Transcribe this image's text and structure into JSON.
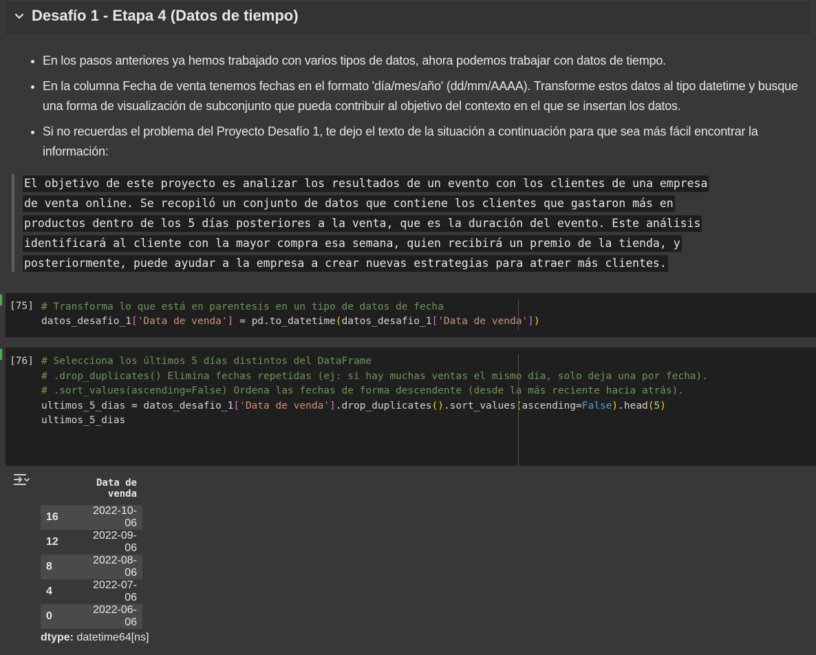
{
  "section": {
    "title": "Desafío 1 - Etapa 4 (Datos de tiempo)"
  },
  "bullets": [
    "En los pasos anteriores ya hemos trabajado con varios tipos de datos, ahora podemos trabajar con datos de tiempo.",
    "En la columna Fecha de venta tenemos fechas en el formato 'día/mes/año' (dd/mm/AAAA). Transforme estos datos al tipo datetime y busque una forma de visualización de subconjunto que pueda contribuir al objetivo del contexto en el que se insertan los datos.",
    "Si no recuerdas el problema del Proyecto Desafío 1, te dejo el texto de la situación a continuación para que sea más fácil encontrar la información:"
  ],
  "quote": [
    "El objetivo de este proyecto es analizar los resultados de un evento con los clientes de una empresa",
    "de venta online. Se recopiló un conjunto de datos que contiene los clientes que gastaron más en",
    "productos dentro de los 5 días posteriores a la venta, que es la duración del evento. Este análisis",
    "identificará al cliente con la mayor compra esa semana, quien recibirá un premio de la tienda, y",
    "posteriormente, puede ayudar a la empresa a crear nuevas estrategias para atraer más clientes."
  ],
  "cell1": {
    "count": "[75]",
    "comment": "# Transforma lo que está en parentesis en un tipo de datos de fecha",
    "l2_a": "datos_desafio_1",
    "l2_str1": "'Data de venda'",
    "l2_b": " = pd.to_datetime",
    "l2_c": "datos_desafio_1",
    "l2_str2": "'Data de venda'"
  },
  "cell2": {
    "count": "[76]",
    "comment1": "# Selecciona los últimos 5 días distintos del DataFrame",
    "comment2": "# .drop_duplicates() Elimina fechas repetidas (ej: si hay muchas ventas el mismo día, solo deja una por fecha).",
    "comment3": "# .sort_values(ascending=False) Ordena las fechas de forma descendente (desde la más reciente hacia atrás).",
    "l4_a": "ultimos_5_dias = datos_desafio_1",
    "l4_str": "'Data de venda'",
    "l4_b": ".drop_duplicates",
    "l4_c": ".sort_values",
    "l4_d": "ascending=",
    "l4_kw": "False",
    "l4_e": ".head",
    "l4_num": "5",
    "l5": "ultimos_5_dias"
  },
  "output": {
    "column": "Data de venda",
    "rows": [
      {
        "index": "16",
        "value": "2022-10-06"
      },
      {
        "index": "12",
        "value": "2022-09-06"
      },
      {
        "index": "8",
        "value": "2022-08-06"
      },
      {
        "index": "4",
        "value": "2022-07-06"
      },
      {
        "index": "0",
        "value": "2022-06-06"
      }
    ],
    "dtype_label": "dtype:",
    "dtype_value": " datetime64[ns]"
  }
}
